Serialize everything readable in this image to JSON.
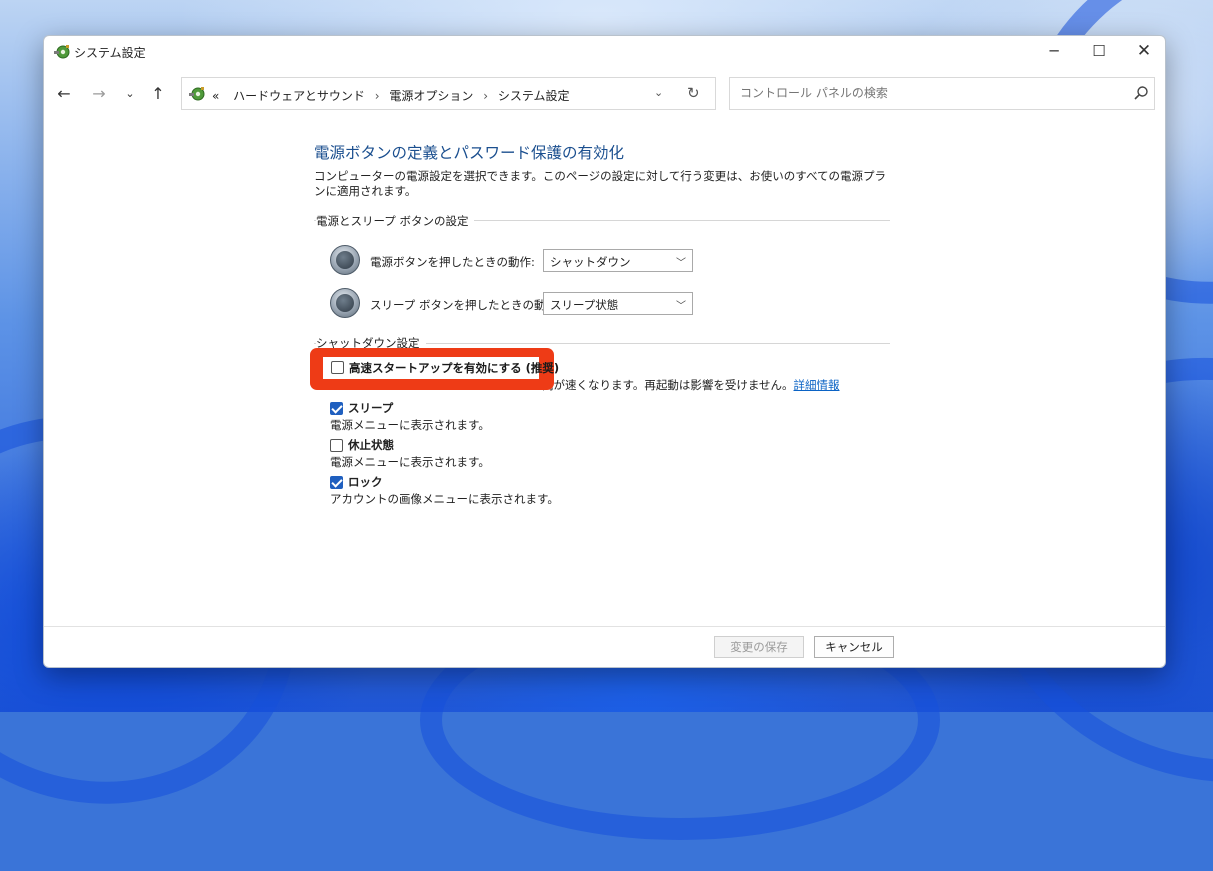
{
  "window": {
    "title": "システム設定",
    "controls": {
      "minimize": "─",
      "maximize": "☐",
      "close": "✕"
    }
  },
  "nav": {
    "breadcrumb": [
      "ハードウェアとサウンド",
      "電源オプション",
      "システム設定"
    ],
    "breadcrumb_prefix": "«",
    "breadcrumb_separator": "›"
  },
  "search": {
    "placeholder": "コントロール パネルの検索"
  },
  "page": {
    "heading": "電源ボタンの定義とパスワード保護の有効化",
    "description": "コンピューターの電源設定を選択できます。このページの設定に対して行う変更は、お使いのすべての電源プランに適用されます。",
    "power_section_title": "電源とスリープ ボタンの設定",
    "power_button_label": "電源ボタンを押したときの動作:",
    "power_button_value": "シャットダウン",
    "sleep_button_label": "スリープ ボタンを押したときの動作:",
    "sleep_button_value": "スリープ状態",
    "shutdown_section_title": "シャットダウン設定",
    "fast_startup": {
      "label": "高速スタートアップを有効にする (推奨)",
      "checked": false,
      "description_visible": "間が速くなります。再起動は影響を受けません。",
      "link": "詳細情報"
    },
    "sleep_option": {
      "label": "スリープ",
      "checked": true,
      "description": "電源メニューに表示されます。"
    },
    "hibernate_option": {
      "label": "休止状態",
      "checked": false,
      "description": "電源メニューに表示されます。"
    },
    "lock_option": {
      "label": "ロック",
      "checked": true,
      "description": "アカウントの画像メニューに表示されます。"
    }
  },
  "footer": {
    "save_label": "変更の保存",
    "cancel_label": "キャンセル"
  },
  "colors": {
    "highlight": "#ee3b16",
    "heading": "#1b4f8f",
    "link": "#0b63c5",
    "checkbox_checked": "#1f5fbf"
  }
}
